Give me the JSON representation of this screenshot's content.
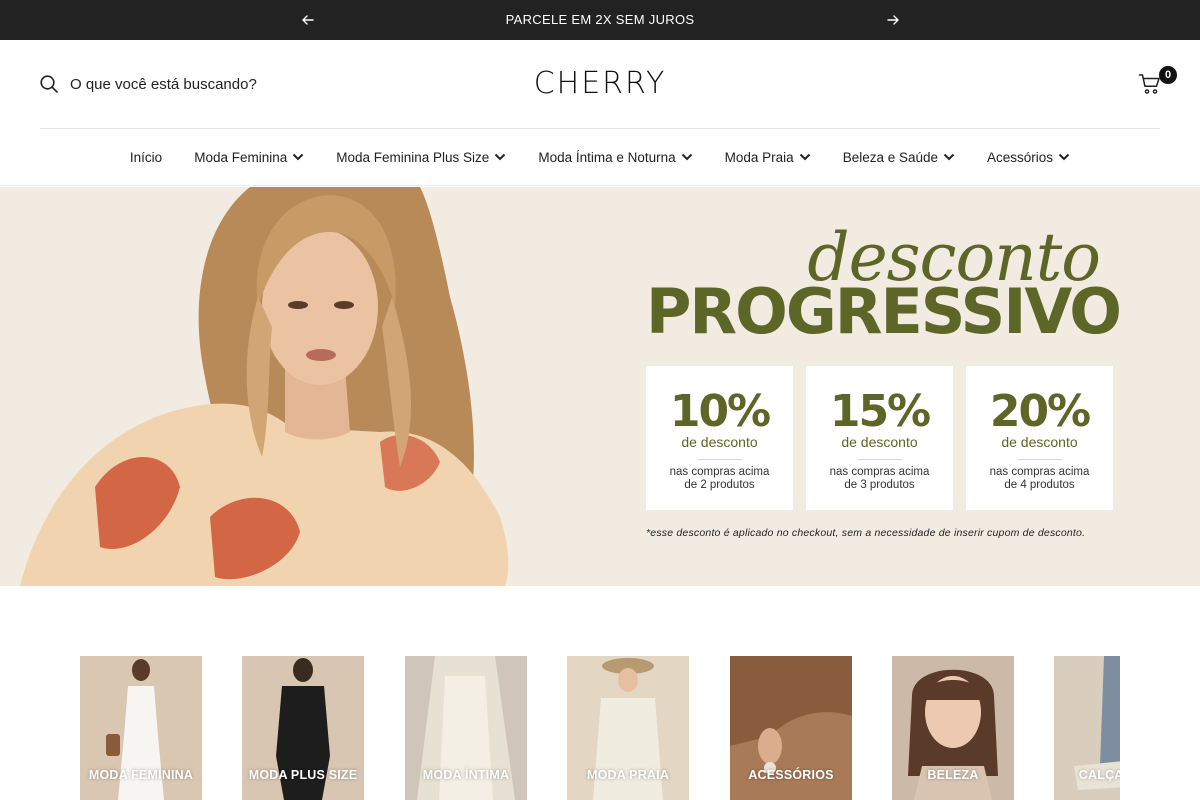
{
  "announcement": {
    "text": "PARCELE EM 2X SEM JUROS",
    "prev_icon": "arrow-left-icon",
    "next_icon": "arrow-right-icon"
  },
  "header": {
    "search_placeholder": "O que você está buscando?",
    "logo": "CHERRY",
    "cart_count": "0",
    "cart_icon": "cart-icon",
    "search_icon": "search-icon"
  },
  "nav": {
    "items": [
      {
        "label": "Início"
      },
      {
        "label": "Moda Feminina"
      },
      {
        "label": "Moda Feminina Plus Size"
      },
      {
        "label": "Moda Íntima e Noturna"
      },
      {
        "label": "Moda Praia"
      },
      {
        "label": "Beleza e Saúde"
      },
      {
        "label": "Acessórios"
      }
    ]
  },
  "hero": {
    "script_text": "desconto",
    "big_text": "PROGRESSIVO",
    "cards": [
      {
        "pct": "10%",
        "sub": "de desconto",
        "cond1": "nas compras acima",
        "cond2": "de 2 produtos"
      },
      {
        "pct": "15%",
        "sub": "de desconto",
        "cond1": "nas compras acima",
        "cond2": "de 3 produtos"
      },
      {
        "pct": "20%",
        "sub": "de desconto",
        "cond1": "nas compras acima",
        "cond2": "de 4 produtos"
      }
    ],
    "note": "*esse desconto é aplicado no checkout, sem a necessidade de inserir cupom de desconto.",
    "colors": {
      "background": "#f1ebe2",
      "accent": "#5d6527"
    }
  },
  "categories": [
    {
      "label": "MODA FEMININA"
    },
    {
      "label": "MODA PLUS SIZE"
    },
    {
      "label": "MODA ÍNTIMA"
    },
    {
      "label": "MODA PRAIA"
    },
    {
      "label": "ACESSÓRIOS"
    },
    {
      "label": "BELEZA"
    },
    {
      "label": "CALÇADOS"
    }
  ]
}
